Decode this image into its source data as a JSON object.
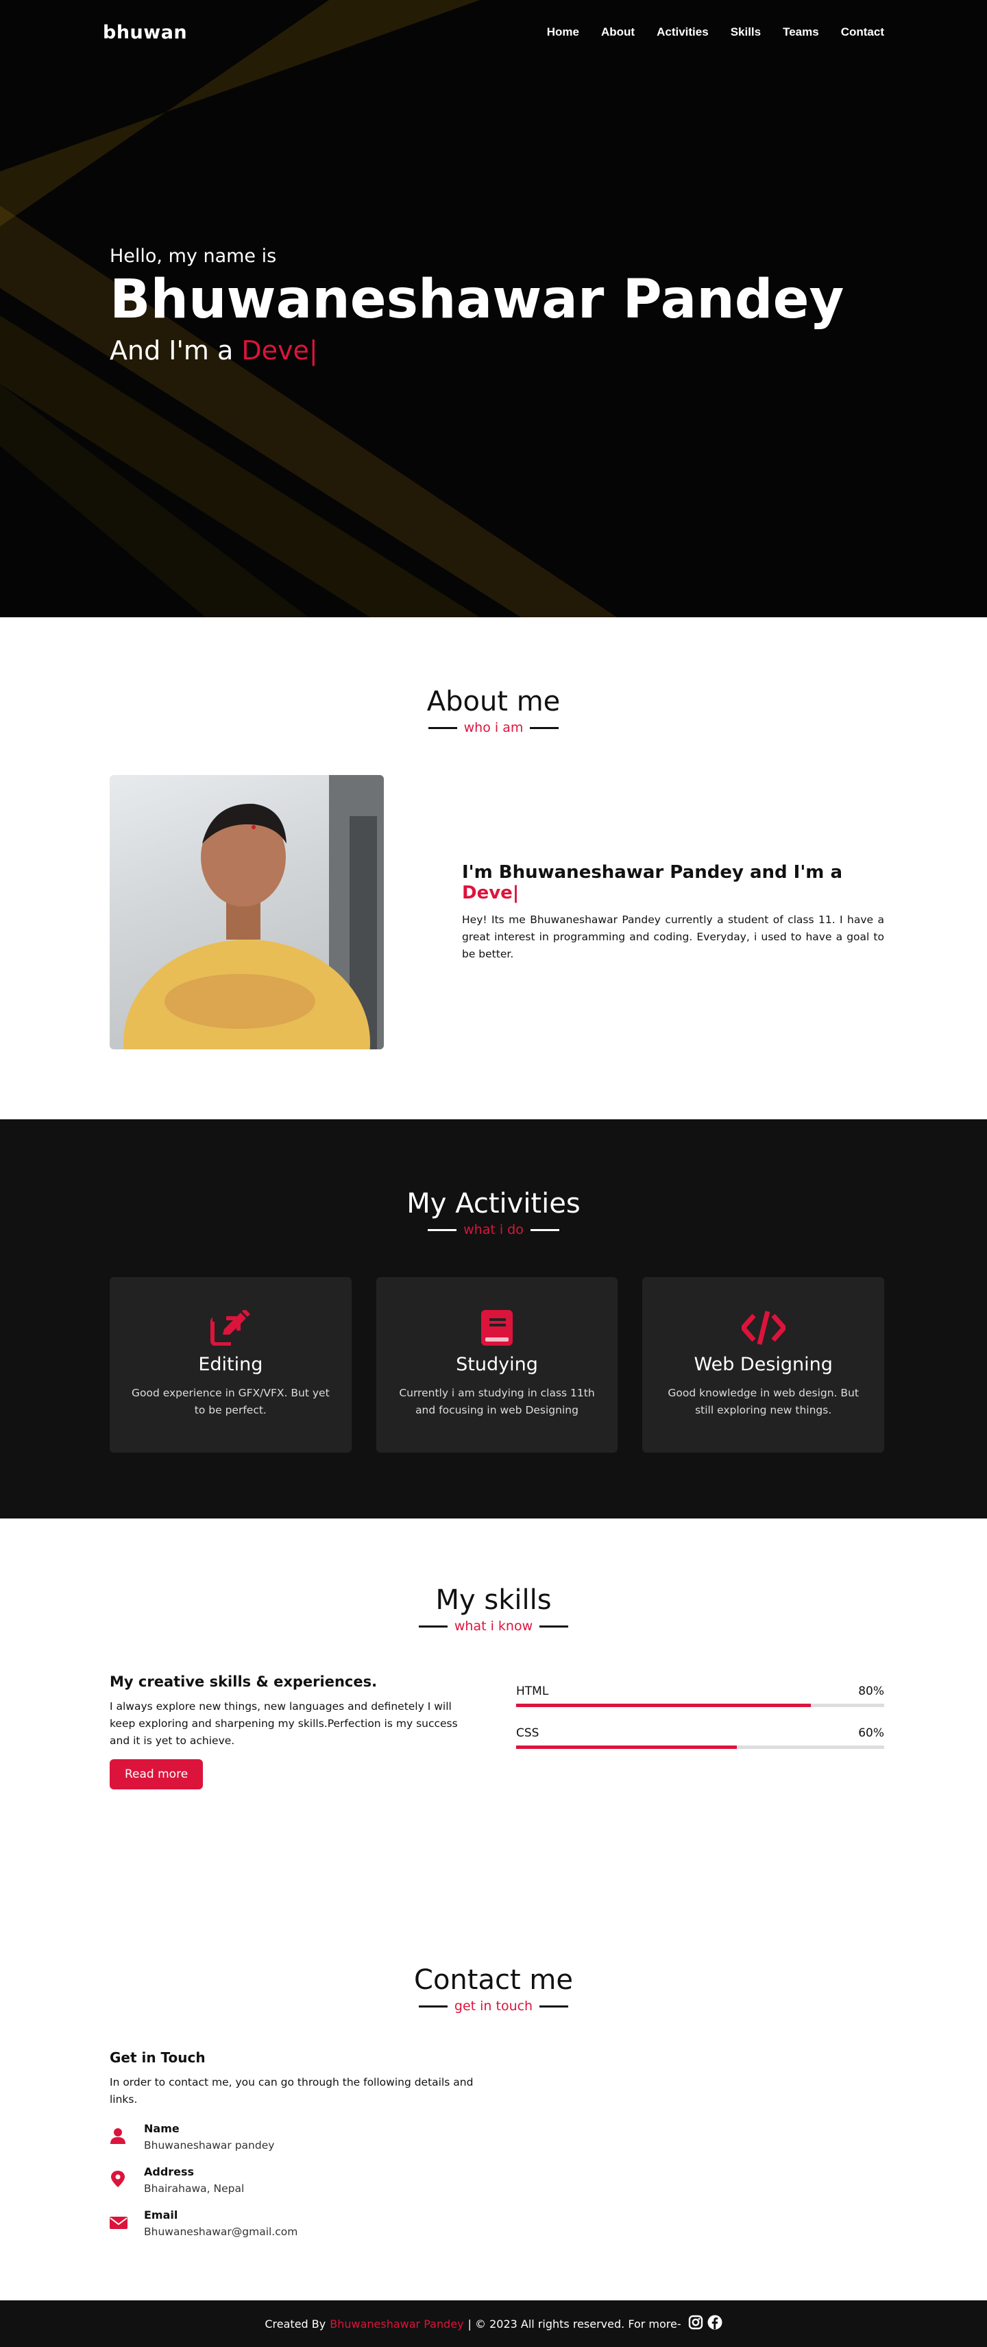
{
  "nav": {
    "logo": "bhuwan",
    "items": [
      {
        "label": "Home"
      },
      {
        "label": "About"
      },
      {
        "label": "Activities"
      },
      {
        "label": "Skills"
      },
      {
        "label": "Teams"
      },
      {
        "label": "Contact"
      }
    ]
  },
  "hero": {
    "hello": "Hello, my name is",
    "name": "Bhuwaneshawar Pandey",
    "role_prefix": "And I'm a",
    "role_typed": "Deve|"
  },
  "about": {
    "title": "About me",
    "subtitle": "who i am",
    "heading_prefix": "I'm Bhuwaneshawar Pandey and I'm a",
    "heading_typed": "Deve|",
    "text": "Hey! Its me Bhuwaneshawar Pandey currently a student of class 11. I have a great interest in programming and coding. Everyday, i used to have a goal to be better."
  },
  "activities": {
    "title": "My Activities",
    "subtitle": "what i do",
    "cards": [
      {
        "icon": "edit-icon",
        "title": "Editing",
        "text": "Good experience in GFX/VFX. But yet to be perfect."
      },
      {
        "icon": "book-icon",
        "title": "Studying",
        "text": "Currently i am studying in class 11th and focusing in web Designing"
      },
      {
        "icon": "code-icon",
        "title": "Web Designing",
        "text": "Good knowledge in web design. But still exploring new things."
      }
    ]
  },
  "skills": {
    "title": "My skills",
    "subtitle": "what i know",
    "heading": "My creative skills & experiences.",
    "text": "I always explore new things, new languages and definetely I will keep exploring and sharpening my skills.Perfection is my success and it is yet to achieve.",
    "button": "Read more",
    "bars": [
      {
        "name": "HTML",
        "percent_label": "80%",
        "value": 80
      },
      {
        "name": "CSS",
        "percent_label": "60%",
        "value": 60
      }
    ]
  },
  "contact": {
    "title": "Contact me",
    "subtitle": "get in touch",
    "heading": "Get in Touch",
    "intro": "In order to contact me, you can go through the following details and links.",
    "items": [
      {
        "icon": "user-icon",
        "label": "Name",
        "value": "Bhuwaneshawar pandey"
      },
      {
        "icon": "map-marker-icon",
        "label": "Address",
        "value": "Bhairahawa, Nepal"
      },
      {
        "icon": "envelope-icon",
        "label": "Email",
        "value": "Bhuwaneshawar@gmail.com"
      }
    ]
  },
  "footer": {
    "created_by": "Created By",
    "name": "Bhuwaneshawar Pandey",
    "rights": "| © 2023 All rights reserved. For more-",
    "icons": [
      "instagram-icon",
      "facebook-icon"
    ]
  },
  "colors": {
    "accent": "#dc143c",
    "dark": "#111111",
    "card": "#222222",
    "hero_beam": "#b8860b"
  }
}
